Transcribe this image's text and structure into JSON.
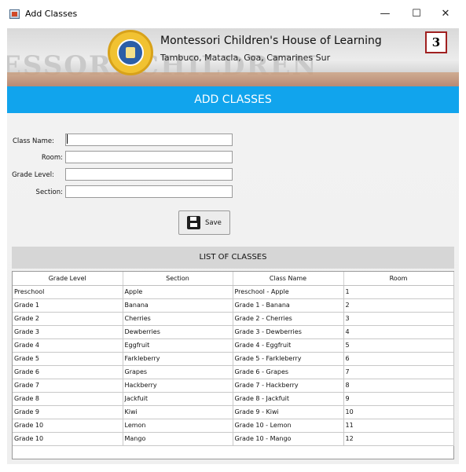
{
  "window": {
    "title": "Add Classes",
    "controls": {
      "minimize": "—",
      "maximize": "☐",
      "close": "✕"
    }
  },
  "banner": {
    "school_name": "Montessori Children's House of Learning",
    "address": "Tambuco, Matacla, Goa, Camarines Sur",
    "badge": "3",
    "background_text": "ESSORI CHILDREN"
  },
  "header": {
    "title": "ADD CLASSES"
  },
  "form": {
    "class_name_label": "Class Name:",
    "room_label": "Room:",
    "grade_level_label": "Grade Level:",
    "section_label": "Section:",
    "class_name_value": "",
    "room_value": "",
    "grade_level_value": "",
    "section_value": "",
    "save_label": "Save"
  },
  "list": {
    "title": "LIST OF CLASSES",
    "columns": [
      "Grade Level",
      "Section",
      "Class Name",
      "Room"
    ],
    "rows": [
      [
        "Preschool",
        "Apple",
        "Preschool - Apple",
        "1"
      ],
      [
        "Grade 1",
        "Banana",
        "Grade 1 - Banana",
        "2"
      ],
      [
        "Grade 2",
        "Cherries",
        "Grade 2 - Cherries",
        "3"
      ],
      [
        "Grade 3",
        "Dewberries",
        "Grade 3 - Dewberries",
        "4"
      ],
      [
        "Grade 4",
        "Eggfruit",
        "Grade 4 - Eggfruit",
        "5"
      ],
      [
        "Grade 5",
        "Farkleberry",
        "Grade 5 - Farkleberry",
        "6"
      ],
      [
        "Grade 6",
        "Grapes",
        "Grade 6 - Grapes",
        "7"
      ],
      [
        "Grade 7",
        "Hackberry",
        "Grade 7 - Hackberry",
        "8"
      ],
      [
        "Grade 8",
        "Jackfuit",
        "Grade 8 - Jackfuit",
        "9"
      ],
      [
        "Grade 9",
        "Kiwi",
        "Grade 9 - Kiwi",
        "10"
      ],
      [
        "Grade 10",
        "Lemon",
        "Grade 10 - Lemon",
        "11"
      ],
      [
        "Grade 10",
        "Mango",
        "Grade 10 - Mango",
        "12"
      ]
    ]
  }
}
